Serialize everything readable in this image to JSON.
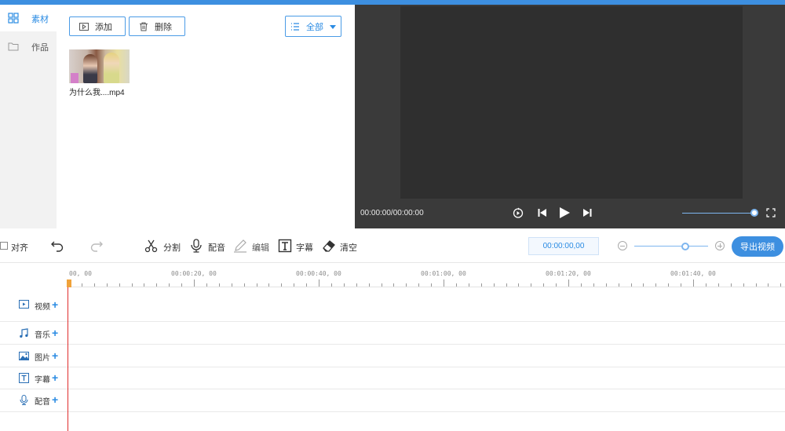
{
  "sidebar": {
    "items": [
      {
        "label": "素材",
        "icon": "grid-icon",
        "active": true
      },
      {
        "label": "作品",
        "icon": "folder-icon",
        "active": false
      }
    ]
  },
  "media": {
    "add_label": "添加",
    "delete_label": "删除",
    "filter_label": "全部",
    "items": [
      {
        "name": "为什么我....mp4"
      }
    ]
  },
  "preview": {
    "time": "00:00:00/00:00:00",
    "volume": 1.0
  },
  "toolbar": {
    "align_label": "对齐",
    "split_label": "分割",
    "dub_label": "配音",
    "edit_label": "编辑",
    "subtitle_label": "字幕",
    "clear_label": "清空",
    "timecode": "00:00:00,00",
    "export_label": "导出视频"
  },
  "timeline": {
    "ruler_labels": [
      "00, 00",
      "00:00:20, 00",
      "00:00:40, 00",
      "00:01:00, 00",
      "00:01:20, 00",
      "00:01:40, 00"
    ],
    "tracks": [
      {
        "label": "视频",
        "icon": "video-icon"
      },
      {
        "label": "音乐",
        "icon": "music-icon"
      },
      {
        "label": "图片",
        "icon": "image-icon"
      },
      {
        "label": "字幕",
        "icon": "text-icon"
      },
      {
        "label": "配音",
        "icon": "mic-icon"
      }
    ]
  },
  "colors": {
    "accent": "#3d8fe0",
    "playhead": "#e02c2c",
    "preview_bg": "#3a3a3a"
  }
}
